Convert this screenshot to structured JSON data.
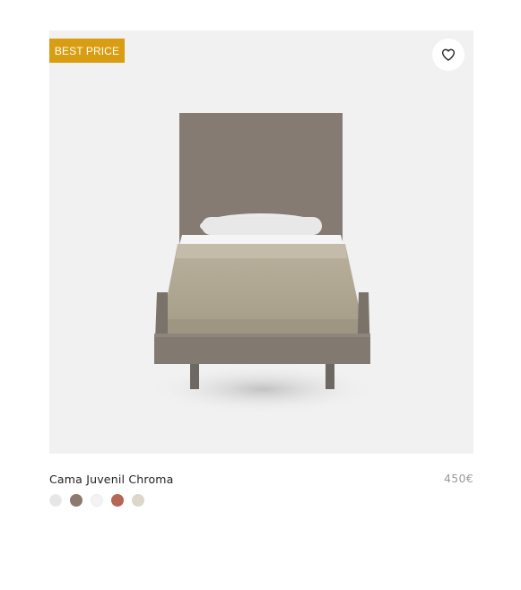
{
  "product": {
    "badge": "BEST PRICE",
    "name": "Cama Juvenil Chroma",
    "price": "450€",
    "wishlist_icon": "heart-outline-icon",
    "swatches": [
      {
        "color": "#e6e6e6"
      },
      {
        "color": "#8b7a6d"
      },
      {
        "color": "#f3f3f3"
      },
      {
        "color": "#b56654"
      },
      {
        "color": "#ddd6cb"
      }
    ]
  },
  "colors": {
    "badge_bg": "#d99d12",
    "image_bg": "#f1f1f1",
    "price_text": "#9a9a9a"
  }
}
